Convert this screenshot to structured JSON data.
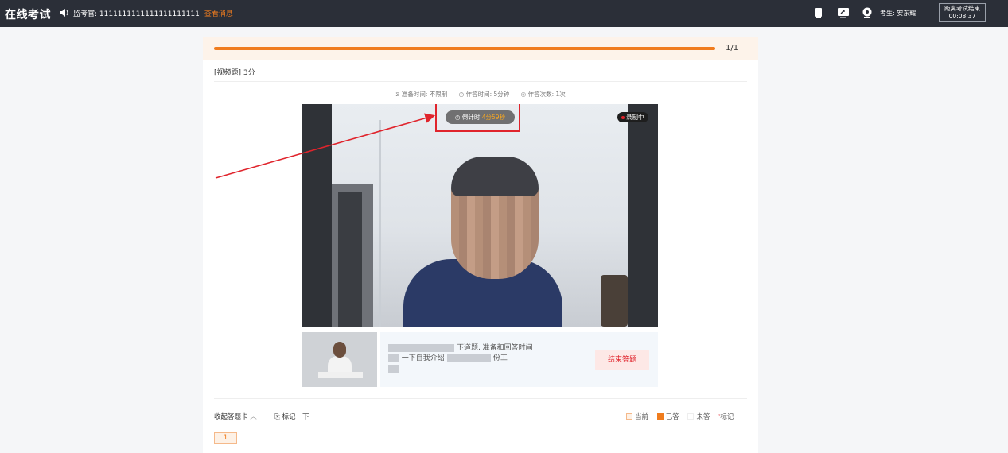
{
  "topbar": {
    "brand": "在线考试",
    "proctor_label": "监考官: 1111111111111111111111",
    "view_message": "查看消息",
    "examinee": "考生: 安东耀",
    "timer_label": "距离考试结束",
    "timer_value": "00:08:37"
  },
  "progress": {
    "text": "1/1",
    "fraction": 1.0
  },
  "question": {
    "type_label": "[视频题] 3分",
    "prep_time": "准备时间: 不限制",
    "answer_time": "作答时间: 5分钟",
    "answer_count": "作答次数: 1次"
  },
  "video": {
    "countdown_label": "倒计时",
    "countdown_value": "4分59秒",
    "recording_label": "录制中"
  },
  "instruction": {
    "line1": "下道题, 准备和回答时间",
    "line2": "一下自我介绍",
    "line3": "份工",
    "end_button": "结束答题"
  },
  "answer_card": {
    "collapse_label": "收起答题卡",
    "mark_label": "标记一下",
    "legend": {
      "current": "当前",
      "answered": "已答",
      "unanswered": "未答",
      "marked": "标记"
    },
    "question_numbers": [
      "1"
    ]
  },
  "colors": {
    "accent": "#f07c1e",
    "topbar": "#2b2f38",
    "annotation": "#e0242c"
  }
}
